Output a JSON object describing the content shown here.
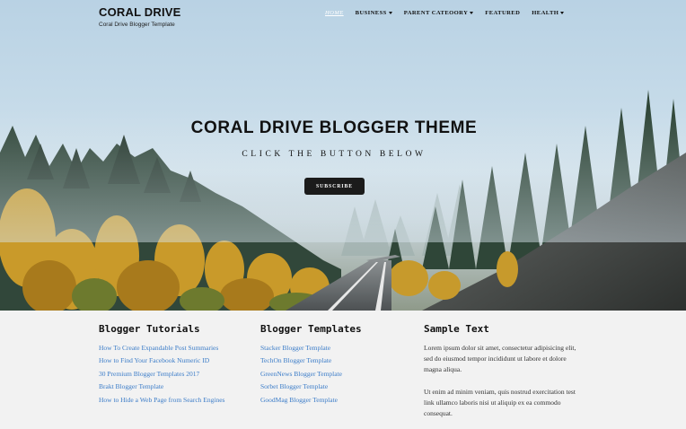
{
  "brand": {
    "title": "CORAL DRIVE",
    "tagline": "Coral Drive Blogger Template"
  },
  "nav": {
    "home": "HOME",
    "business": "BUSINESS",
    "parent_category": "PARENT CATEOORY",
    "featured": "FEATURED",
    "health": "HEALTH"
  },
  "hero": {
    "title": "CORAL DRIVE BLOGGER THEME",
    "subtitle": "CLICK THE BUTTON BELOW",
    "button": "SUBSCRIBE"
  },
  "widgets": {
    "tutorials": {
      "heading": "Blogger Tutorials",
      "links": [
        "How To Create Expandable Post Summaries",
        "How to Find Your Facebook Numeric ID",
        "30 Premium Blogger Templates 2017",
        "Brakt Blogger Template",
        "How to Hide a Web Page from Search Engines"
      ]
    },
    "templates": {
      "heading": "Blogger Templates",
      "links": [
        "Stacker Blogger Template",
        "TechOn Blogger Template",
        "GreenNews Blogger Template",
        "Sorbet Blogger Template",
        "GoodMag Blogger Template"
      ]
    },
    "sample": {
      "heading": "Sample Text",
      "para1": "Lorem ipsum dolor sit amet, consectetur adipisicing elit, sed do eiusmod tempor incididunt ut labore et dolore magna aliqua.",
      "para2": "Ut enim ad minim veniam, quis nostrud exercitation test link ullamco laboris nisi ut aliquip ex ea commodo consequat."
    }
  },
  "colors": {
    "link": "#3b7cc8",
    "button_bg": "#1b1b1b",
    "footer_bg": "#f2f2f2"
  }
}
